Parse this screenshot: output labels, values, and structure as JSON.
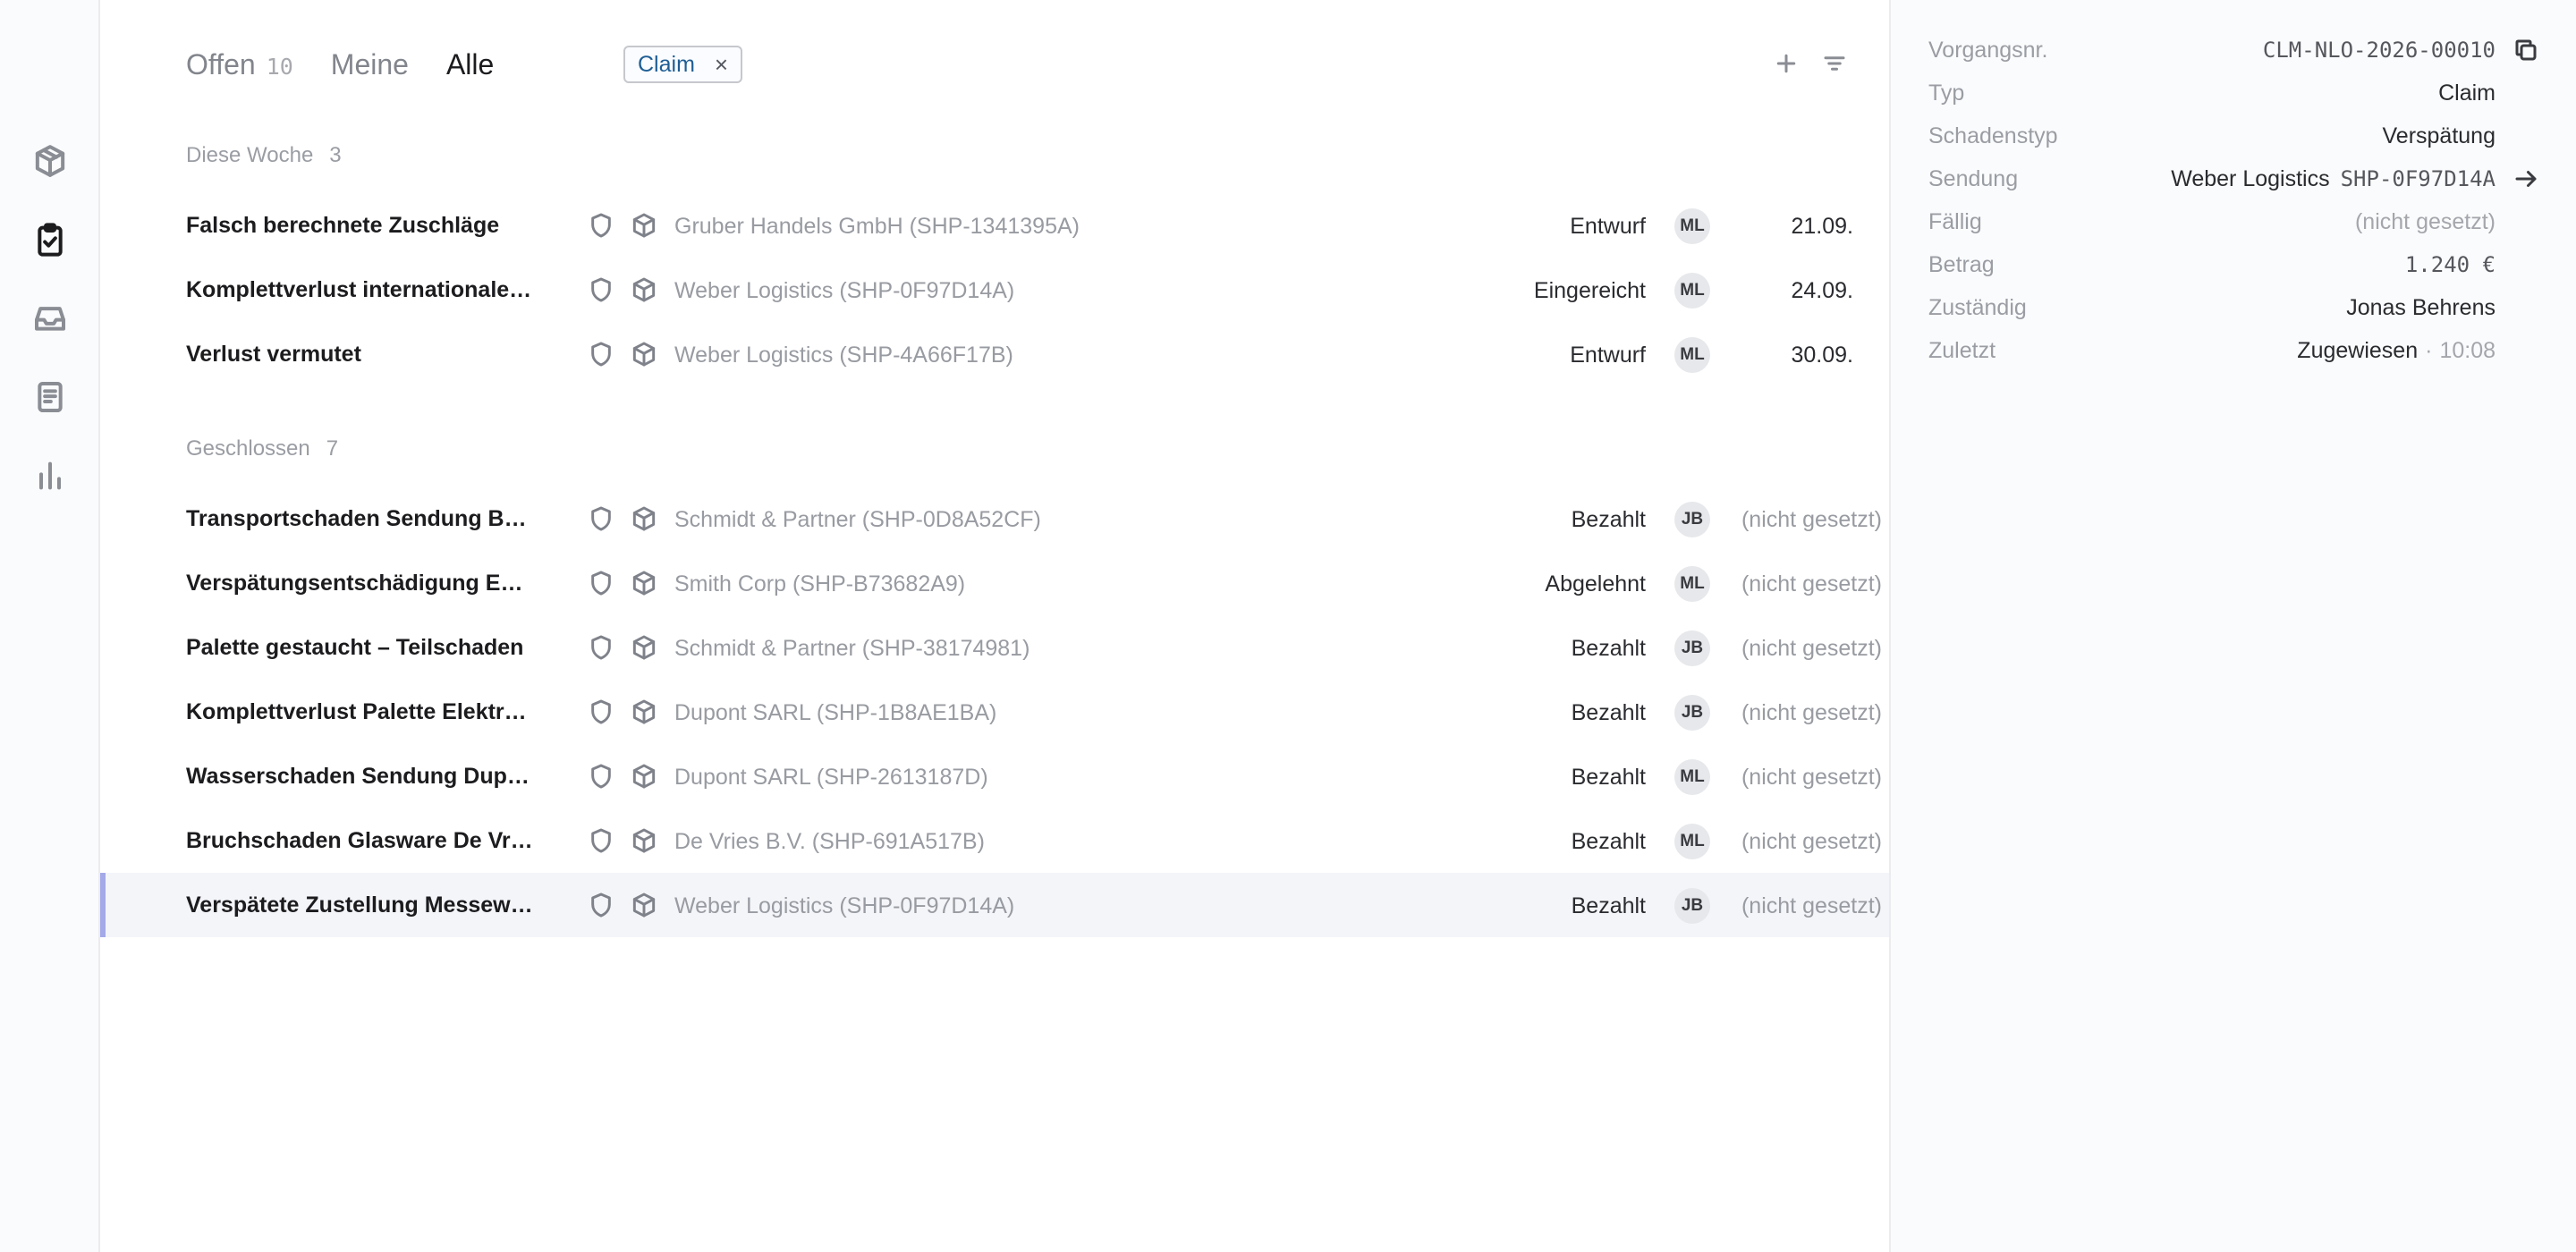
{
  "rail": {
    "items": [
      {
        "icon": "package-icon"
      },
      {
        "icon": "clipboard-check-icon",
        "active": true
      },
      {
        "icon": "inbox-icon"
      },
      {
        "icon": "document-icon"
      },
      {
        "icon": "bar-chart-icon"
      }
    ]
  },
  "tabs": [
    {
      "label": "Offen",
      "count": "10"
    },
    {
      "label": "Meine",
      "count": ""
    },
    {
      "label": "Alle",
      "count": "",
      "active": true
    }
  ],
  "filter_chip": {
    "label": "Claim",
    "remove": "×"
  },
  "groups": [
    {
      "label": "Diese Woche",
      "count": "3",
      "rows": [
        {
          "title": "Falsch berechnete Zuschläge",
          "shipment": "Gruber Handels GmbH (SHP-1341395A)",
          "status": "Entwurf",
          "assignee": "ML",
          "date": "21.09."
        },
        {
          "title": "Komplettverlust internationale Sendung",
          "shipment": "Weber Logistics (SHP-0F97D14A)",
          "status": "Eingereicht",
          "assignee": "ML",
          "date": "24.09."
        },
        {
          "title": "Verlust vermutet",
          "shipment": "Weber Logistics (SHP-4A66F17B)",
          "status": "Entwurf",
          "assignee": "ML",
          "date": "30.09."
        }
      ]
    },
    {
      "label": "Geschlossen",
      "count": "7",
      "rows": [
        {
          "title": "Transportschaden Sendung Berlin",
          "shipment": "Schmidt & Partner (SHP-0D8A52CF)",
          "status": "Bezahlt",
          "assignee": "JB",
          "date": "(nicht gesetzt)"
        },
        {
          "title": "Verspätungsentschädigung Express",
          "shipment": "Smith Corp (SHP-B73682A9)",
          "status": "Abgelehnt",
          "assignee": "ML",
          "date": "(nicht gesetzt)"
        },
        {
          "title": "Palette gestaucht – Teilschaden",
          "shipment": "Schmidt & Partner (SHP-38174981)",
          "status": "Bezahlt",
          "assignee": "JB",
          "date": "(nicht gesetzt)"
        },
        {
          "title": "Komplettverlust Palette Elektronik",
          "shipment": "Dupont SARL (SHP-1B8AE1BA)",
          "status": "Bezahlt",
          "assignee": "JB",
          "date": "(nicht gesetzt)"
        },
        {
          "title": "Wasserschaden Sendung Dupont",
          "shipment": "Dupont SARL (SHP-2613187D)",
          "status": "Bezahlt",
          "assignee": "ML",
          "date": "(nicht gesetzt)"
        },
        {
          "title": "Bruchschaden Glasware De Vries",
          "shipment": "De Vries B.V. (SHP-691A517B)",
          "status": "Bezahlt",
          "assignee": "ML",
          "date": "(nicht gesetzt)"
        },
        {
          "title": "Verspätete Zustellung Messeware",
          "shipment": "Weber Logistics (SHP-0F97D14A)",
          "status": "Bezahlt",
          "assignee": "JB",
          "date": "(nicht gesetzt)",
          "selected": true
        }
      ]
    }
  ],
  "detail": {
    "vorgangsnr": {
      "label": "Vorgangsnr.",
      "value": "CLM-NLO-2026-00010"
    },
    "typ": {
      "label": "Typ",
      "value": "Claim"
    },
    "schadenstyp": {
      "label": "Schadenstyp",
      "value": "Verspätung"
    },
    "sendung": {
      "label": "Sendung",
      "name": "Weber Logistics",
      "id": "SHP-0F97D14A"
    },
    "faellig": {
      "label": "Fällig",
      "value": "(nicht gesetzt)"
    },
    "betrag": {
      "label": "Betrag",
      "value": "1.240 €"
    },
    "zustaendig": {
      "label": "Zuständig",
      "value": "Jonas Behrens"
    },
    "zuletzt": {
      "label": "Zuletzt",
      "value": "Zugewiesen",
      "separator": "·",
      "time": "10:08"
    }
  }
}
